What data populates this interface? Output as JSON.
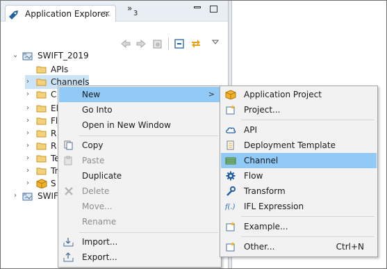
{
  "explorer": {
    "tab_title": "Application Explorer",
    "overflow_count": "3",
    "tab_close_glyph": "×",
    "overflow_glyph": "»"
  },
  "tree": {
    "project": "SWIFT_2019",
    "items": [
      {
        "label": "APIs",
        "twisty": false
      },
      {
        "label": "Channels",
        "twisty": true,
        "selected": true
      },
      {
        "label": "C",
        "twisty": true
      },
      {
        "label": "El",
        "twisty": true
      },
      {
        "label": "Fl",
        "twisty": true
      },
      {
        "label": "R",
        "twisty": true
      },
      {
        "label": "R",
        "twisty": true
      },
      {
        "label": "Te",
        "twisty": true
      },
      {
        "label": "Tr",
        "twisty": true
      },
      {
        "label": "S",
        "twisty": true
      }
    ],
    "project2": "SWIF"
  },
  "context_menu": {
    "items": [
      {
        "label": "New",
        "has_submenu": true,
        "highlighted": true
      },
      {
        "label": "Go Into"
      },
      {
        "label": "Open in New Window"
      },
      {
        "label": "Copy"
      },
      {
        "label": "Paste",
        "disabled": true
      },
      {
        "label": "Duplicate"
      },
      {
        "label": "Delete",
        "disabled": true
      },
      {
        "label": "Move...",
        "disabled": true
      },
      {
        "label": "Rename",
        "disabled": true
      },
      {
        "label": "Import..."
      },
      {
        "label": "Export..."
      }
    ],
    "submenu_arrow": ">"
  },
  "submenu": {
    "items": [
      {
        "label": "Application Project",
        "icon": "application-project-icon"
      },
      {
        "label": "Project...",
        "icon": "project-icon"
      },
      {
        "label": "API",
        "icon": "cloud-icon"
      },
      {
        "label": "Deployment Template",
        "icon": "deployment-template-icon"
      },
      {
        "label": "Channel",
        "icon": "channel-icon",
        "highlighted": true
      },
      {
        "label": "Flow",
        "icon": "gear-icon"
      },
      {
        "label": "Transform",
        "icon": "wrench-icon"
      },
      {
        "label": "IFL Expression",
        "icon": "function-icon"
      },
      {
        "label": "Example...",
        "icon": "example-icon"
      },
      {
        "label": "Other...",
        "icon": "other-icon",
        "shortcut": "Ctrl+N"
      }
    ]
  },
  "colors": {
    "highlight": "#91c9f7",
    "menu_bg": "#f2f2f2",
    "folder": "#e8b84a",
    "selection": "#cde4f7"
  }
}
